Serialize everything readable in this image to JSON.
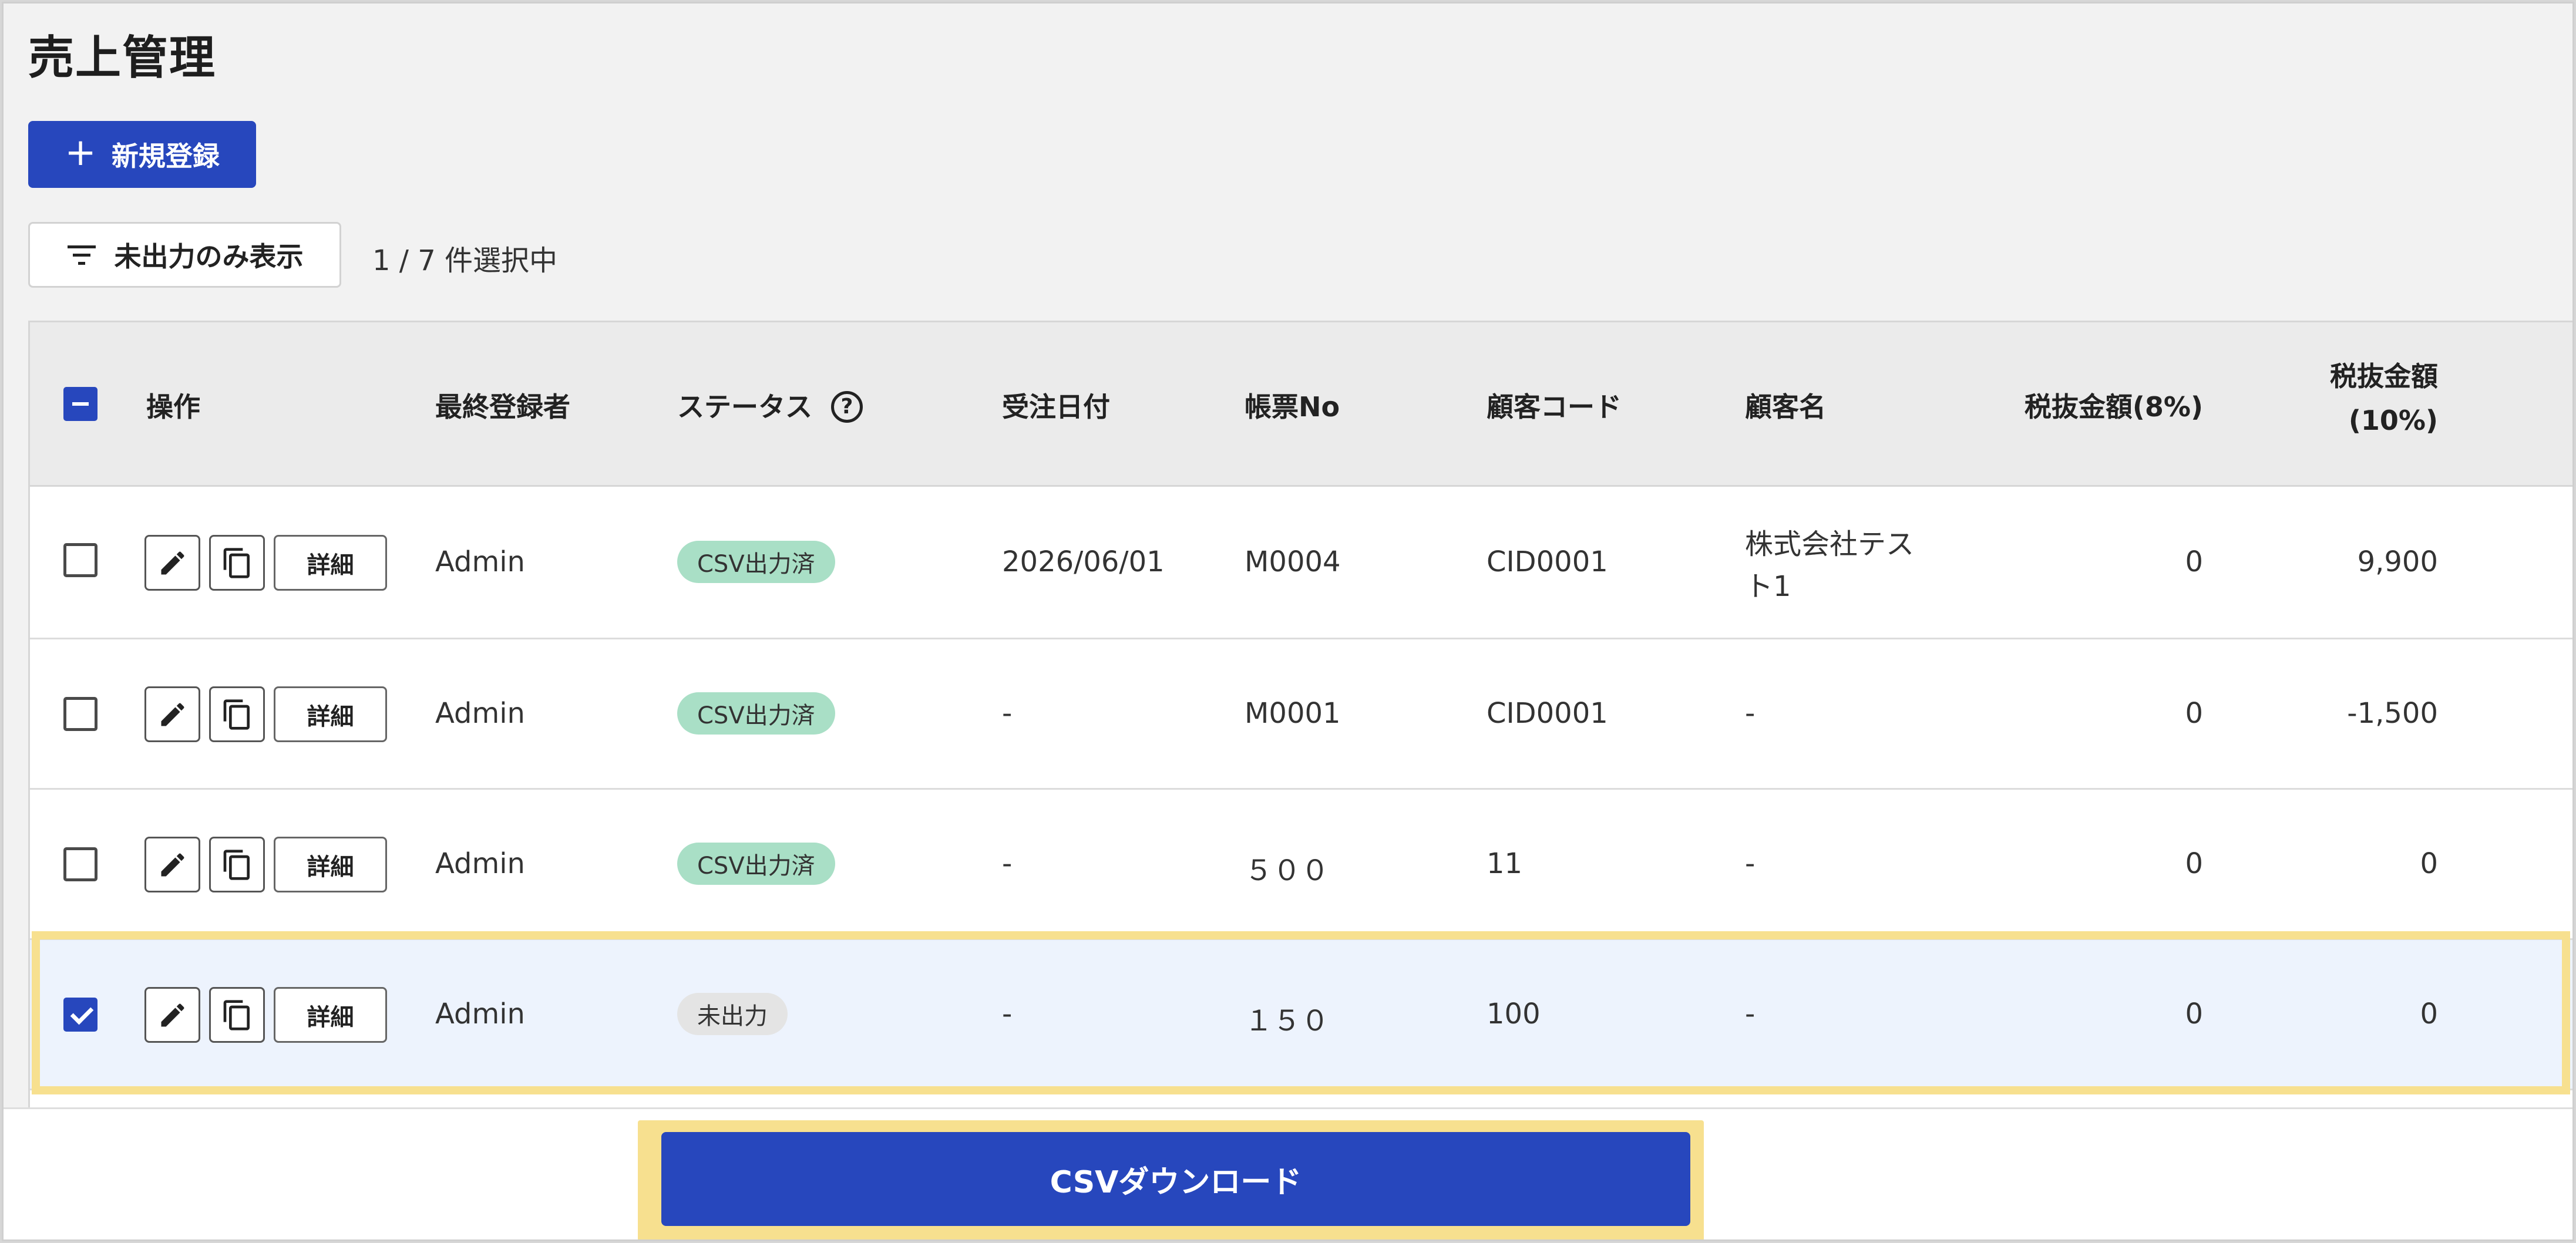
{
  "page": {
    "title": "売上管理",
    "new_button_label": "新規登録",
    "filter_button_label": "未出力のみ表示",
    "selection_count": "1 / 7 件選択中"
  },
  "table": {
    "headers": {
      "operation": "操作",
      "last_registrant": "最終登録者",
      "status": "ステータス",
      "order_date": "受注日付",
      "form_no": "帳票No",
      "customer_code": "顧客コード",
      "customer_name": "顧客名",
      "amount_8": "税抜金額(8%)",
      "amount_10_line1": "税抜金額",
      "amount_10_line2": "(10%)"
    },
    "detail_label": "詳細",
    "rows": [
      {
        "checked": false,
        "registrant": "Admin",
        "status": "CSV出力済",
        "status_type": "done",
        "order_date": "2026/06/01",
        "form_no": "M0004",
        "customer_code": "CID0001",
        "customer_name_line1": "株式会社テス",
        "customer_name_line2": "ト1",
        "amount_8": "0",
        "amount_10": "9,900"
      },
      {
        "checked": false,
        "registrant": "Admin",
        "status": "CSV出力済",
        "status_type": "done",
        "order_date": "-",
        "form_no": "M0001",
        "customer_code": "CID0001",
        "customer_name_line1": "-",
        "customer_name_line2": "",
        "amount_8": "0",
        "amount_10": "-1,500"
      },
      {
        "checked": false,
        "registrant": "Admin",
        "status": "CSV出力済",
        "status_type": "done",
        "order_date": "-",
        "form_no": "５００",
        "customer_code": "11",
        "customer_name_line1": "-",
        "customer_name_line2": "",
        "amount_8": "0",
        "amount_10": "0"
      },
      {
        "checked": true,
        "registrant": "Admin",
        "status": "未出力",
        "status_type": "pending",
        "order_date": "-",
        "form_no": "１５０",
        "customer_code": "100",
        "customer_name_line1": "-",
        "customer_name_line2": "",
        "amount_8": "0",
        "amount_10": "0"
      }
    ]
  },
  "footer": {
    "csv_download_label": "CSVダウンロード"
  },
  "icons": {
    "plus": "plus-icon",
    "filter": "filter-icon",
    "help": "help-icon",
    "edit": "pencil-icon",
    "copy": "copy-icon"
  },
  "colors": {
    "primary": "#2747bd",
    "done_badge": "#a9dfc6",
    "pending_badge": "#e4e4e4",
    "highlight": "#f7e08f",
    "selected_row": "#edf3fd"
  }
}
